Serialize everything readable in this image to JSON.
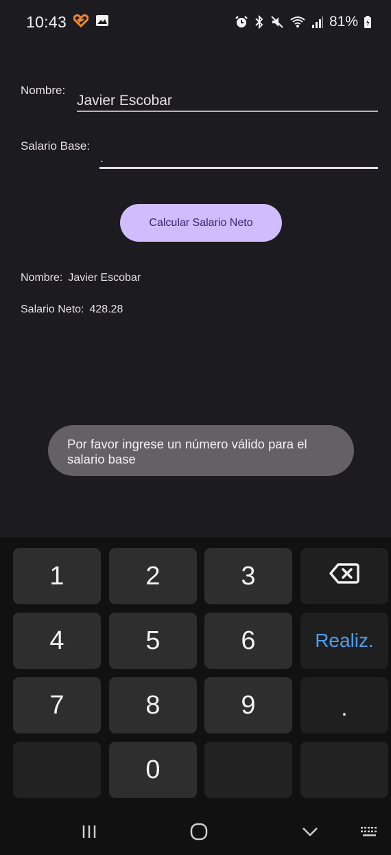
{
  "status_bar": {
    "time": "10:43",
    "battery": "81%",
    "icons": [
      "notification-heart-icon",
      "gallery-icon",
      "alarm-icon",
      "bluetooth-icon",
      "mute-icon",
      "wifi-icon",
      "signal-icon",
      "battery-icon"
    ]
  },
  "form": {
    "name_label": "Nombre:",
    "name_value": "Javier Escobar",
    "salary_label": "Salario Base:",
    "salary_value": ".",
    "calculate_button": "Calcular Salario Neto"
  },
  "results": {
    "name_label": "Nombre:",
    "name_value": "Javier Escobar",
    "net_label": "Salario Neto:",
    "net_value": "428.28"
  },
  "toast": {
    "message": "Por favor ingrese un número válido para el salario base"
  },
  "keyboard": {
    "keys": [
      "1",
      "2",
      "3",
      "4",
      "5",
      "6",
      "7",
      "8",
      "9",
      "0"
    ],
    "done_label": "Realiz.",
    "decimal_label": "."
  },
  "colors": {
    "background": "#1c1b1f",
    "button": "#d0bcff",
    "button_text": "#381e72",
    "done_key": "#4b9ff2"
  }
}
